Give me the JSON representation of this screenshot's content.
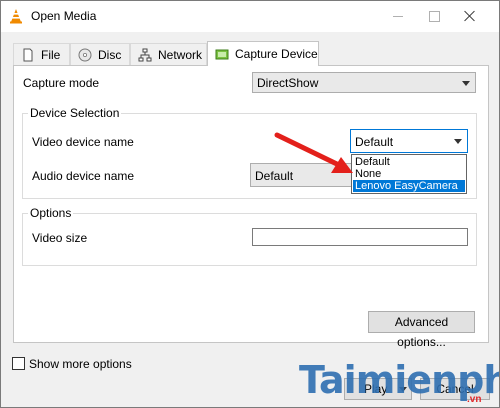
{
  "window": {
    "title": "Open Media"
  },
  "tabs": [
    {
      "label": "File",
      "icon": "file-icon"
    },
    {
      "label": "Disc",
      "icon": "disc-icon"
    },
    {
      "label": "Network",
      "icon": "network-icon"
    },
    {
      "label": "Capture Device",
      "icon": "capture-device-icon",
      "active": true
    }
  ],
  "capture_mode": {
    "label": "Capture mode",
    "value": "DirectShow"
  },
  "device_selection": {
    "title": "Device Selection",
    "video_label": "Video device name",
    "video_value": "Default",
    "audio_label": "Audio device name",
    "audio_value": "Default",
    "dropdown_options": [
      "Default",
      "None",
      "Lenovo EasyCamera"
    ],
    "highlighted_option": "Lenovo EasyCamera"
  },
  "options": {
    "title": "Options",
    "video_size_label": "Video size",
    "video_size_value": ""
  },
  "buttons": {
    "advanced": "Advanced options...",
    "play": "Play",
    "cancel": "Cancel"
  },
  "show_more": {
    "label": "Show more options",
    "checked": false
  },
  "watermark": {
    "text": "Taimienphi",
    "suffix": ".vn"
  },
  "colors": {
    "accent": "#0078d7",
    "arrow": "#e3201b",
    "watermark": "#2f6fb1"
  }
}
